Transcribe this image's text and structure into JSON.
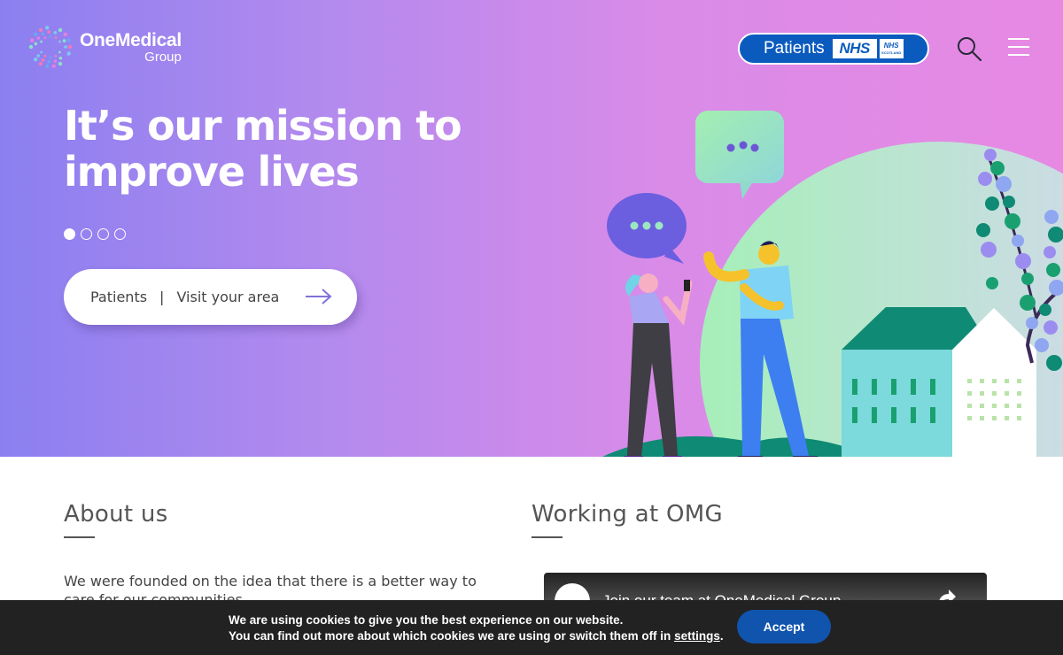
{
  "header": {
    "logo_name": "OneMedical",
    "logo_sub": "Group",
    "patients_button_label": "Patients",
    "nhs_badge": "NHS",
    "nhs_scotland_top": "NHS",
    "nhs_scotland_bottom": "SCOTLAND",
    "search_icon": "search-icon",
    "menu_icon": "hamburger-menu-icon"
  },
  "hero": {
    "title_line1": "It’s our mission to",
    "title_line2": "improve lives",
    "slides": [
      {
        "active": true
      },
      {
        "active": false
      },
      {
        "active": false
      },
      {
        "active": false
      }
    ],
    "cta": {
      "label_left": "Patients",
      "separator": "|",
      "label_right": "Visit your area",
      "icon": "arrow-right-icon"
    },
    "colors": {
      "gradient_start": "#8b7ff0",
      "gradient_end": "#e789e3"
    }
  },
  "about": {
    "heading": "About us",
    "text": "We were founded on the idea that there is a better way to care for our communities."
  },
  "working": {
    "heading": "Working at OMG",
    "video_title": "Join our team at OneMedical Group",
    "share_icon": "share-icon"
  },
  "cookie": {
    "line1": "We are using cookies to give you the best experience on our website.",
    "line2_prefix": "You can find out more about which cookies we are using or switch them off in ",
    "link": "settings",
    "line2_suffix": ".",
    "accept_label": "Accept"
  }
}
